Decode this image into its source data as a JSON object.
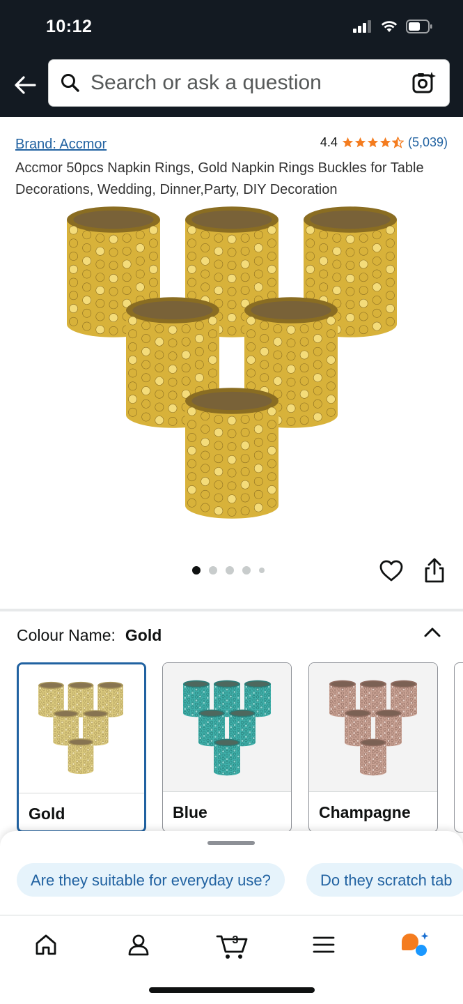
{
  "status_bar": {
    "time": "10:12"
  },
  "search": {
    "placeholder": "Search or ask a question"
  },
  "product": {
    "brand": "Brand: Accmor",
    "rating": "4.4",
    "review_count": "(5,039)",
    "title": "Accmor 50pcs Napkin Rings, Gold Napkin Rings Buckles for Table Decorations, Wedding, Dinner,Party, DIY Decoration",
    "image_count": 5,
    "active_image": 1
  },
  "colour": {
    "label": "Colour Name:",
    "selected": "Gold",
    "options": [
      {
        "label": "Gold",
        "color": "#d9c46a"
      },
      {
        "label": "Blue",
        "color": "#4fb7b0"
      },
      {
        "label": "Champagne",
        "color": "#c9a79a"
      }
    ]
  },
  "suggestions": [
    "Are they suitable for everyday use?",
    "Do they scratch tab"
  ],
  "nav": {
    "cart_count": "3",
    "icons": [
      "home-icon",
      "account-icon",
      "cart-icon",
      "menu-icon",
      "rufus-icon"
    ]
  },
  "colors": {
    "header_bg": "#131a22",
    "link": "#2162a1",
    "star": "#f47c1f",
    "chip_bg": "#e6f3fb"
  }
}
